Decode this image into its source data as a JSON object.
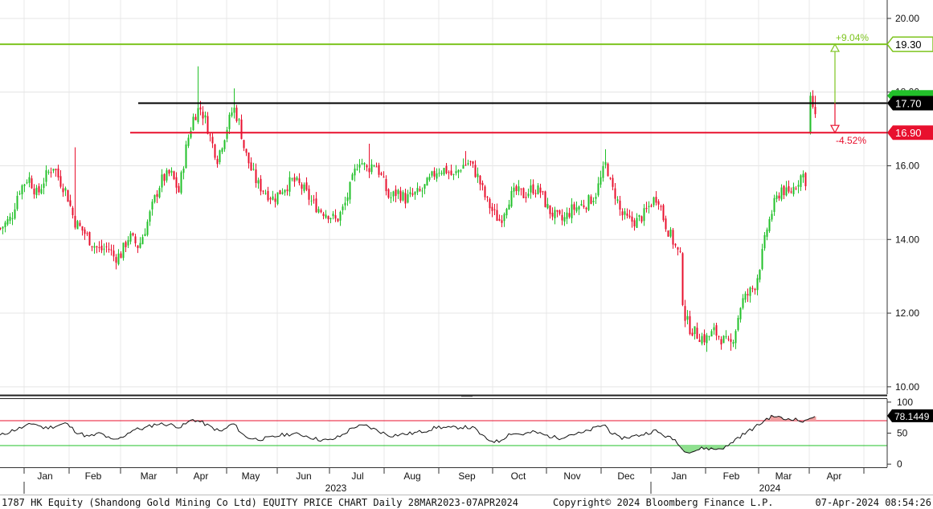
{
  "chart_data": [
    {
      "type": "candlestick",
      "ylim": [
        9.8,
        20.5
      ],
      "yticks": [
        "10.00",
        "12.00",
        "14.00",
        "16.00",
        "18.00",
        "20.00"
      ],
      "months": [
        "Jan",
        "Feb",
        "Mar",
        "Apr",
        "May",
        "Jun",
        "Jul",
        "Aug",
        "Sep",
        "Oct",
        "Nov",
        "Dec",
        "Jan",
        "Feb",
        "Mar",
        "Apr"
      ],
      "years": [
        "2023",
        "2024"
      ],
      "series_colors": {
        "up": "#22c02a",
        "down": "#e8102e"
      },
      "close_anchors": [
        [
          0,
          14.3
        ],
        [
          14,
          14.6
        ],
        [
          22,
          15.3
        ],
        [
          35,
          15.7
        ],
        [
          46,
          15.2
        ],
        [
          56,
          15.7
        ],
        [
          66,
          16.0
        ],
        [
          74,
          15.6
        ],
        [
          82,
          15.3
        ],
        [
          92,
          14.5
        ],
        [
          104,
          14.2
        ],
        [
          114,
          13.9
        ],
        [
          124,
          13.7
        ],
        [
          134,
          13.8
        ],
        [
          142,
          13.5
        ],
        [
          150,
          13.6
        ],
        [
          160,
          14.1
        ],
        [
          172,
          13.8
        ],
        [
          182,
          14.4
        ],
        [
          192,
          15.1
        ],
        [
          200,
          15.6
        ],
        [
          212,
          15.8
        ],
        [
          222,
          15.3
        ],
        [
          232,
          16.6
        ],
        [
          240,
          17.3
        ],
        [
          248,
          17.6
        ],
        [
          256,
          17.2
        ],
        [
          262,
          16.7
        ],
        [
          270,
          16.2
        ],
        [
          280,
          16.9
        ],
        [
          290,
          17.6
        ],
        [
          298,
          17.1
        ],
        [
          304,
          16.4
        ],
        [
          312,
          15.9
        ],
        [
          320,
          15.5
        ],
        [
          330,
          15.3
        ],
        [
          340,
          15.1
        ],
        [
          352,
          15.4
        ],
        [
          364,
          15.6
        ],
        [
          376,
          15.4
        ],
        [
          388,
          15.0
        ],
        [
          398,
          14.8
        ],
        [
          408,
          14.7
        ],
        [
          418,
          14.5
        ],
        [
          428,
          14.9
        ],
        [
          438,
          15.6
        ],
        [
          446,
          16.2
        ],
        [
          456,
          15.9
        ],
        [
          466,
          16.1
        ],
        [
          474,
          15.7
        ],
        [
          484,
          15.1
        ],
        [
          494,
          15.3
        ],
        [
          504,
          15.1
        ],
        [
          514,
          15.2
        ],
        [
          524,
          15.3
        ],
        [
          534,
          15.6
        ],
        [
          544,
          15.9
        ],
        [
          554,
          15.9
        ],
        [
          564,
          15.7
        ],
        [
          574,
          16.0
        ],
        [
          584,
          16.1
        ],
        [
          594,
          15.7
        ],
        [
          604,
          15.1
        ],
        [
          614,
          14.7
        ],
        [
          622,
          14.5
        ],
        [
          632,
          15.1
        ],
        [
          642,
          15.3
        ],
        [
          652,
          15.2
        ],
        [
          662,
          15.4
        ],
        [
          672,
          15.3
        ],
        [
          682,
          14.8
        ],
        [
          692,
          14.6
        ],
        [
          700,
          14.5
        ],
        [
          710,
          14.8
        ],
        [
          720,
          14.9
        ],
        [
          730,
          15.0
        ],
        [
          740,
          15.2
        ],
        [
          748,
          15.7
        ],
        [
          754,
          16.1
        ],
        [
          760,
          15.4
        ],
        [
          766,
          15.2
        ],
        [
          772,
          14.7
        ],
        [
          782,
          14.5
        ],
        [
          792,
          14.5
        ],
        [
          802,
          14.7
        ],
        [
          810,
          15.0
        ],
        [
          818,
          15.2
        ],
        [
          826,
          14.5
        ],
        [
          836,
          14.0
        ],
        [
          846,
          13.5
        ],
        [
          850,
          12.0
        ],
        [
          858,
          11.6
        ],
        [
          868,
          11.4
        ],
        [
          878,
          11.3
        ],
        [
          888,
          11.5
        ],
        [
          898,
          11.3
        ],
        [
          908,
          11.1
        ],
        [
          914,
          11.5
        ],
        [
          922,
          12.3
        ],
        [
          930,
          12.5
        ],
        [
          940,
          12.8
        ],
        [
          948,
          13.6
        ],
        [
          954,
          14.3
        ],
        [
          962,
          14.9
        ],
        [
          972,
          15.4
        ],
        [
          980,
          15.2
        ],
        [
          990,
          15.5
        ],
        [
          998,
          15.8
        ],
        [
          1004,
          15.5
        ]
      ],
      "extra_bars": [
        {
          "x": 1008,
          "open": 16.9,
          "close": 17.9,
          "high": 18.0,
          "low": 16.85
        },
        {
          "x": 1011,
          "open": 17.9,
          "close": 17.6,
          "high": 18.05,
          "low": 17.55
        },
        {
          "x": 1014,
          "open": 17.6,
          "close": 17.4,
          "high": 17.9,
          "low": 17.3
        }
      ],
      "spikes": [
        {
          "x": 92,
          "high": 16.5
        },
        {
          "x": 246,
          "high": 18.7
        },
        {
          "x": 290,
          "high": 18.1
        },
        {
          "x": 458,
          "high": 16.6
        },
        {
          "x": 580,
          "high": 16.4
        },
        {
          "x": 754,
          "high": 16.45
        },
        {
          "x": 880,
          "low": 10.95
        },
        {
          "x": 908,
          "low": 10.98
        }
      ],
      "hlines": [
        {
          "value": 19.3,
          "label": "19.30",
          "color": "#7dc41f",
          "x_start": 0
        },
        {
          "value": 17.7,
          "label": "17.70",
          "color": "#000000",
          "x_start": 172
        },
        {
          "value": 16.9,
          "label": "16.90",
          "color": "#e8102e",
          "x_start": 162
        }
      ],
      "last_price_tag": {
        "value": 17.9,
        "color": "#22c02a"
      },
      "annotations": [
        {
          "text": "+9.04%",
          "value": 19.3,
          "color": "#7dc41f"
        },
        {
          "text": "-4.52%",
          "value": 16.9,
          "color": "#e8102e"
        }
      ],
      "arrow": {
        "x": 1039,
        "from": 17.7,
        "to_up": 19.3,
        "to_down": 16.9
      }
    },
    {
      "type": "line",
      "ylim": [
        -5,
        105
      ],
      "yticks": [
        "0",
        "50",
        "100"
      ],
      "overbought": 70,
      "oversold": 30,
      "last_value": "78.1449",
      "rsi_anchors": [
        [
          0,
          46
        ],
        [
          15,
          54
        ],
        [
          30,
          60
        ],
        [
          42,
          66
        ],
        [
          55,
          58
        ],
        [
          68,
          61
        ],
        [
          82,
          66
        ],
        [
          95,
          52
        ],
        [
          110,
          44
        ],
        [
          125,
          50
        ],
        [
          140,
          38
        ],
        [
          150,
          42
        ],
        [
          165,
          55
        ],
        [
          180,
          58
        ],
        [
          195,
          65
        ],
        [
          210,
          64
        ],
        [
          225,
          60
        ],
        [
          240,
          72
        ],
        [
          250,
          68
        ],
        [
          262,
          60
        ],
        [
          275,
          52
        ],
        [
          290,
          66
        ],
        [
          305,
          44
        ],
        [
          320,
          40
        ],
        [
          335,
          42
        ],
        [
          350,
          47
        ],
        [
          365,
          49
        ],
        [
          380,
          46
        ],
        [
          395,
          40
        ],
        [
          410,
          38
        ],
        [
          425,
          46
        ],
        [
          440,
          60
        ],
        [
          455,
          62
        ],
        [
          470,
          54
        ],
        [
          485,
          46
        ],
        [
          500,
          48
        ],
        [
          515,
          50
        ],
        [
          530,
          54
        ],
        [
          545,
          60
        ],
        [
          560,
          58
        ],
        [
          575,
          60
        ],
        [
          590,
          58
        ],
        [
          605,
          40
        ],
        [
          620,
          36
        ],
        [
          635,
          50
        ],
        [
          650,
          48
        ],
        [
          665,
          52
        ],
        [
          680,
          46
        ],
        [
          695,
          42
        ],
        [
          710,
          48
        ],
        [
          725,
          50
        ],
        [
          740,
          58
        ],
        [
          752,
          64
        ],
        [
          760,
          52
        ],
        [
          770,
          42
        ],
        [
          785,
          44
        ],
        [
          800,
          48
        ],
        [
          815,
          54
        ],
        [
          830,
          44
        ],
        [
          842,
          38
        ],
        [
          848,
          24
        ],
        [
          860,
          20
        ],
        [
          875,
          26
        ],
        [
          890,
          24
        ],
        [
          905,
          28
        ],
        [
          915,
          40
        ],
        [
          930,
          52
        ],
        [
          945,
          64
        ],
        [
          955,
          74
        ],
        [
          965,
          78
        ],
        [
          975,
          72
        ],
        [
          985,
          74
        ],
        [
          995,
          70
        ],
        [
          1003,
          68
        ],
        [
          1008,
          76
        ],
        [
          1014,
          78
        ]
      ]
    }
  ],
  "footer": {
    "left": "1787 HK Equity (Shandong Gold Mining Co Ltd) EQUITY PRICE CHART  Daily 28MAR2023-07APR2024",
    "center": "Copyright© 2024 Bloomberg Finance L.P.",
    "right": "07-Apr-2024 08:54:26"
  }
}
